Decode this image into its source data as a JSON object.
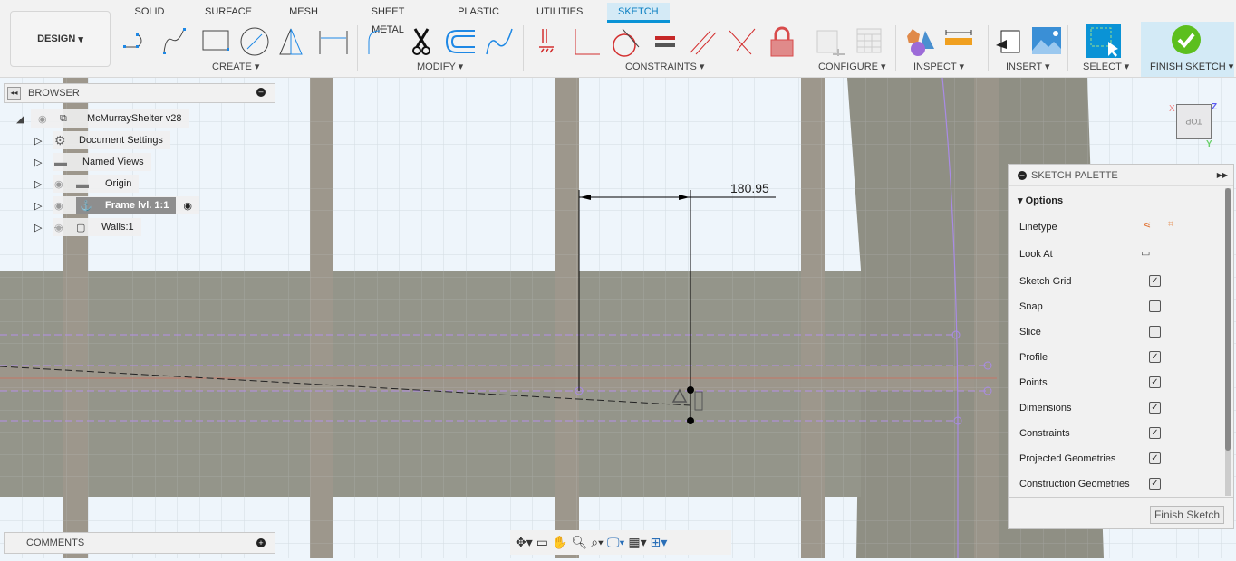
{
  "toolbar": {
    "workspace": "DESIGN",
    "tabs": [
      "SOLID",
      "SURFACE",
      "MESH",
      "SHEET METAL",
      "PLASTIC",
      "UTILITIES",
      "SKETCH"
    ],
    "active_tab": "SKETCH",
    "groups": {
      "create": "CREATE",
      "modify": "MODIFY",
      "constraints": "CONSTRAINTS",
      "configure": "CONFIGURE",
      "inspect": "INSPECT",
      "insert": "INSERT",
      "select": "SELECT",
      "finish": "FINISH SKETCH"
    },
    "accent": "#0a93d6"
  },
  "browser": {
    "title": "BROWSER",
    "items": [
      {
        "label": "McMurrayShelter v28",
        "icon": "component-icon"
      },
      {
        "label": "Document Settings",
        "icon": "gear-icon"
      },
      {
        "label": "Named Views",
        "icon": "folder-icon"
      },
      {
        "label": "Origin",
        "icon": "folder-icon"
      },
      {
        "label": "Frame lvl. 1:1",
        "icon": "component-icon",
        "active": true
      },
      {
        "label": "Walls:1",
        "icon": "body-icon",
        "hidden": true
      }
    ]
  },
  "comments": {
    "title": "COMMENTS"
  },
  "canvas": {
    "dimension": "180.95",
    "viewcube": "TOP",
    "axes": {
      "x": "X",
      "y": "Y",
      "z": "Z"
    }
  },
  "palette": {
    "title": "SKETCH PALETTE",
    "section": "Options",
    "linetype": "Linetype",
    "look_at": "Look At",
    "options": [
      {
        "label": "Sketch Grid",
        "checked": true
      },
      {
        "label": "Snap",
        "checked": false
      },
      {
        "label": "Slice",
        "checked": false
      },
      {
        "label": "Profile",
        "checked": true
      },
      {
        "label": "Points",
        "checked": true
      },
      {
        "label": "Dimensions",
        "checked": true
      },
      {
        "label": "Constraints",
        "checked": true
      },
      {
        "label": "Projected Geometries",
        "checked": true
      },
      {
        "label": "Construction Geometries",
        "checked": true
      }
    ],
    "finish_button": "Finish Sketch"
  }
}
